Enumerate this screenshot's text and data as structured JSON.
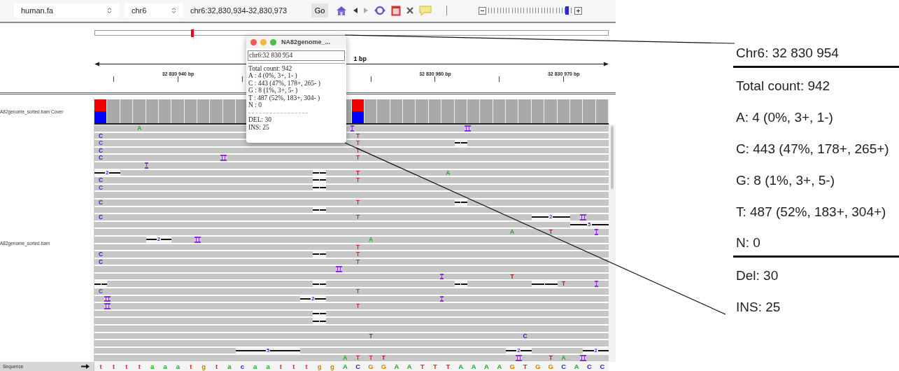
{
  "toolbar": {
    "genome": "human.fa",
    "chromosome": "chr6",
    "locus": "chr6:32,830,934-32,830,973",
    "go": "Go",
    "zoom": {
      "level": 0.93
    }
  },
  "header": {
    "ideogram": {
      "level": 0.19
    },
    "ruler": {
      "span": "1 bp",
      "ticks": [
        "32 830 940 bp",
        "32 830 960 bp",
        "32 830 970 bp"
      ]
    }
  },
  "tracks": {
    "coverage": {
      "label": "A82genome_sorted.bam Cover",
      "alleles": [
        {
          "kind": "mixed"
        },
        {
          "kind": "mixed"
        }
      ]
    },
    "alignments": {
      "label": "A82genome_sorted.bam",
      "rows": [
        {
          "marks": [
            {
              "kind": "adenine",
              "text": "A",
              "faint": false
            },
            {
              "kind": "insertion"
            },
            {
              "kind": "wide_insertion"
            }
          ]
        },
        {
          "marks": [
            {
              "kind": "cytosine",
              "text": "C",
              "faint": false
            },
            {
              "kind": "thymine",
              "text": "T",
              "faint": false
            }
          ]
        },
        {
          "marks": [
            {
              "kind": "cytosine",
              "text": "C",
              "faint": true
            },
            {
              "kind": "thymine",
              "text": "T",
              "faint": false
            },
            {
              "kind": "deletion"
            }
          ]
        },
        {
          "marks": [
            {
              "kind": "cytosine",
              "text": "C",
              "faint": false
            },
            {
              "kind": "thymine",
              "text": "T",
              "faint": false
            }
          ]
        },
        {
          "marks": [
            {
              "kind": "cytosine",
              "text": "C",
              "faint": false
            },
            {
              "kind": "wide_insertion"
            },
            {
              "kind": "thymine",
              "text": "T",
              "faint": false
            }
          ]
        },
        {
          "marks": [
            {
              "kind": "insertion"
            }
          ]
        },
        {
          "marks": [
            {
              "kind": "deletion",
              "text": "2"
            },
            {
              "kind": "deletion"
            },
            {
              "kind": "thymine",
              "text": "T",
              "faint": true
            },
            {
              "kind": "adenine",
              "text": "A",
              "faint": false
            }
          ]
        },
        {
          "marks": [
            {
              "kind": "cytosine",
              "text": "C",
              "faint": false
            },
            {
              "kind": "deletion"
            },
            {
              "kind": "thymine",
              "text": "T",
              "faint": false
            }
          ]
        },
        {
          "marks": [
            {
              "kind": "cytosine",
              "text": "C",
              "faint": true
            },
            {
              "kind": "deletion"
            }
          ]
        },
        {},
        {
          "marks": [
            {
              "kind": "cytosine",
              "text": "C",
              "faint": false
            },
            {
              "kind": "thymine",
              "text": "T",
              "faint": false
            },
            {
              "kind": "deletion"
            }
          ]
        },
        {
          "marks": [
            {
              "kind": "deletion"
            }
          ]
        },
        {
          "marks": [
            {
              "kind": "cytosine",
              "text": "C",
              "faint": false
            },
            {
              "kind": "thymine",
              "text": "T",
              "faint": false
            },
            {
              "kind": "deletion",
              "text": "2"
            },
            {
              "kind": "wide_insertion"
            }
          ]
        },
        {
          "marks": [
            {
              "kind": "deletion",
              "text": "5"
            }
          ]
        },
        {
          "marks": [
            {
              "kind": "adenine",
              "text": "A",
              "faint": false
            },
            {
              "kind": "thymine",
              "text": "T",
              "faint": true
            },
            {
              "kind": "insertion"
            }
          ]
        },
        {
          "marks": [
            {
              "kind": "deletion",
              "text": "2"
            },
            {
              "kind": "wide_insertion"
            },
            {
              "kind": "adenine",
              "text": "A",
              "faint": false
            }
          ]
        },
        {
          "marks": [
            {
              "kind": "thymine",
              "text": "T",
              "faint": false
            }
          ]
        },
        {
          "marks": [
            {
              "kind": "cytosine",
              "text": "C",
              "faint": false
            },
            {
              "kind": "deletion"
            },
            {
              "kind": "thymine",
              "text": "T",
              "faint": false
            }
          ]
        },
        {
          "marks": [
            {
              "kind": "cytosine",
              "text": "C",
              "faint": false
            },
            {
              "kind": "thymine",
              "text": "T",
              "faint": false
            }
          ]
        },
        {
          "marks": [
            {
              "kind": "wide_insertion"
            }
          ]
        },
        {
          "marks": [
            {
              "kind": "insertion"
            },
            {
              "kind": "thymine",
              "text": "T",
              "faint": true
            }
          ]
        },
        {
          "marks": [
            {
              "kind": "deletion"
            },
            {
              "kind": "deletion"
            },
            {
              "kind": "deletion"
            },
            {
              "kind": "deletion"
            },
            {
              "kind": "thymine",
              "text": "T",
              "faint": true
            },
            {
              "kind": "insertion"
            }
          ]
        },
        {
          "marks": [
            {
              "kind": "cytosine",
              "text": "C",
              "faint": true
            },
            {
              "kind": "thymine",
              "text": "T",
              "faint": false
            }
          ]
        },
        {
          "marks": [
            {
              "kind": "wide_insertion"
            },
            {
              "kind": "deletion",
              "text": "2"
            },
            {
              "kind": "insertion"
            }
          ]
        },
        {
          "marks": [
            {
              "kind": "wide_insertion"
            },
            {
              "kind": "thymine",
              "text": "T",
              "faint": false
            }
          ]
        },
        {
          "marks": [
            {
              "kind": "deletion"
            }
          ]
        },
        {
          "marks": [
            {
              "kind": "deletion"
            }
          ]
        },
        {},
        {
          "marks": [
            {
              "kind": "thymine",
              "text": "T",
              "faint": true
            },
            {
              "kind": "cytosine",
              "text": "C",
              "faint": false
            }
          ]
        },
        {},
        {
          "marks": [
            {
              "kind": "deletion",
              "text": "5"
            },
            {
              "kind": "deletion",
              "text": "2"
            },
            {
              "kind": "deletion",
              "text": "2"
            }
          ]
        },
        {
          "marks": [
            {
              "kind": "adenine",
              "text": "A",
              "faint": false
            },
            {
              "kind": "thymine",
              "text": "T",
              "faint": false
            },
            {
              "kind": "thymine",
              "text": "T",
              "faint": false
            },
            {
              "kind": "thymine",
              "text": "T",
              "faint": true
            },
            {
              "kind": "wide_insertion"
            },
            {
              "kind": "thymine",
              "text": "T",
              "faint": true
            },
            {
              "kind": "adenine",
              "text": "A",
              "faint": false
            },
            {
              "kind": "wide_insertion"
            }
          ]
        }
      ]
    },
    "sequence": {
      "label": "Sequence",
      "bases": [
        {
          "text": "t",
          "kind": "thymine"
        },
        {
          "text": "t",
          "kind": "thymine"
        },
        {
          "text": "t",
          "kind": "thymine"
        },
        {
          "text": "t",
          "kind": "thymine"
        },
        {
          "text": "a",
          "kind": "adenine"
        },
        {
          "text": "a",
          "kind": "adenine"
        },
        {
          "text": "a",
          "kind": "adenine"
        },
        {
          "text": "t",
          "kind": "thymine"
        },
        {
          "text": "g",
          "kind": "guanine"
        },
        {
          "text": "t",
          "kind": "thymine"
        },
        {
          "text": "a",
          "kind": "adenine"
        },
        {
          "text": "c",
          "kind": "cytosine"
        },
        {
          "text": "a",
          "kind": "adenine"
        },
        {
          "text": "a",
          "kind": "adenine"
        },
        {
          "text": "t",
          "kind": "thymine"
        },
        {
          "text": "t",
          "kind": "thymine"
        },
        {
          "text": "t",
          "kind": "thymine"
        },
        {
          "text": "g",
          "kind": "guanine"
        },
        {
          "text": "g",
          "kind": "guanine"
        },
        {
          "text": "A",
          "kind": "adenine"
        },
        {
          "text": "C",
          "kind": "cytosine"
        },
        {
          "text": "G",
          "kind": "guanine"
        },
        {
          "text": "G",
          "kind": "guanine"
        },
        {
          "text": "A",
          "kind": "adenine"
        },
        {
          "text": "A",
          "kind": "adenine"
        },
        {
          "text": "T",
          "kind": "thymine"
        },
        {
          "text": "T",
          "kind": "thymine"
        },
        {
          "text": "T",
          "kind": "thymine"
        },
        {
          "text": "A",
          "kind": "adenine"
        },
        {
          "text": "A",
          "kind": "adenine"
        },
        {
          "text": "A",
          "kind": "adenine"
        },
        {
          "text": "A",
          "kind": "adenine"
        },
        {
          "text": "G",
          "kind": "guanine"
        },
        {
          "text": "T",
          "kind": "thymine"
        },
        {
          "text": "G",
          "kind": "guanine"
        },
        {
          "text": "G",
          "kind": "guanine"
        },
        {
          "text": "C",
          "kind": "cytosine"
        },
        {
          "text": "A",
          "kind": "adenine"
        },
        {
          "text": "C",
          "kind": "cytosine"
        },
        {
          "text": "C",
          "kind": "cytosine"
        }
      ]
    }
  },
  "popup": {
    "title": "NA82genome_...",
    "position": "chr6:32 830 954",
    "lines": [
      "Total count: 942",
      "A : 4 (0%, 3+, 1- )",
      "C : 443 (47%, 178+, 265- )",
      "G : 8 (1%, 3+, 5- )",
      "T : 487 (52%, 183+, 304- )",
      "N : 0"
    ],
    "indels": [
      "DEL: 30",
      "INS: 25"
    ]
  },
  "notes": {
    "items": [
      {
        "text": "Chr6: 32 830 954",
        "rule_below": true
      },
      {
        "text": "Total count: 942",
        "rule_below": false
      },
      {
        "text": "A: 4 (0%, 3+, 1-)",
        "rule_below": false
      },
      {
        "text": "C: 443 (47%, 178+, 265+)",
        "rule_below": false
      },
      {
        "text": "G: 8 (1%, 3+, 5-)",
        "rule_below": false
      },
      {
        "text": "T: 487 (52%, 183+, 304+)",
        "rule_below": false
      },
      {
        "text": "N: 0",
        "rule_below": true
      },
      {
        "text": "Del: 30",
        "rule_below": false
      },
      {
        "text": "INS: 25",
        "rule_below": false
      }
    ]
  }
}
